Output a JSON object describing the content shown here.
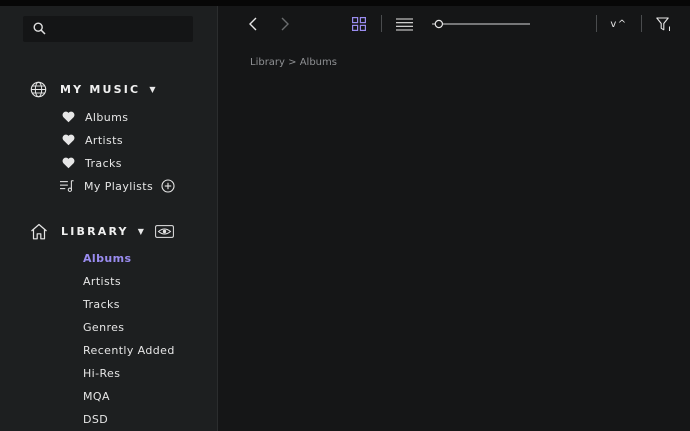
{
  "search": {
    "placeholder": ""
  },
  "my_music": {
    "title": "MY MUSIC",
    "items": [
      {
        "label": "Albums",
        "icon": "heart-icon"
      },
      {
        "label": "Artists",
        "icon": "heart-icon"
      },
      {
        "label": "Tracks",
        "icon": "heart-icon"
      },
      {
        "label": "My Playlists",
        "icon": "playlist-icon"
      }
    ]
  },
  "library": {
    "title": "LIBRARY",
    "items": [
      {
        "label": "Albums",
        "active": true
      },
      {
        "label": "Artists"
      },
      {
        "label": "Tracks"
      },
      {
        "label": "Genres"
      },
      {
        "label": "Recently Added"
      },
      {
        "label": "Hi-Res"
      },
      {
        "label": "MQA"
      },
      {
        "label": "DSD"
      }
    ]
  },
  "toolbar": {
    "view_mode": "grid",
    "zoom": 0.07,
    "sort_label": "v^"
  },
  "breadcrumb": "Library > Albums",
  "colors": {
    "accent": "#9a8cf0",
    "sidebar_bg": "#1d1f20",
    "main_bg": "#151617"
  }
}
